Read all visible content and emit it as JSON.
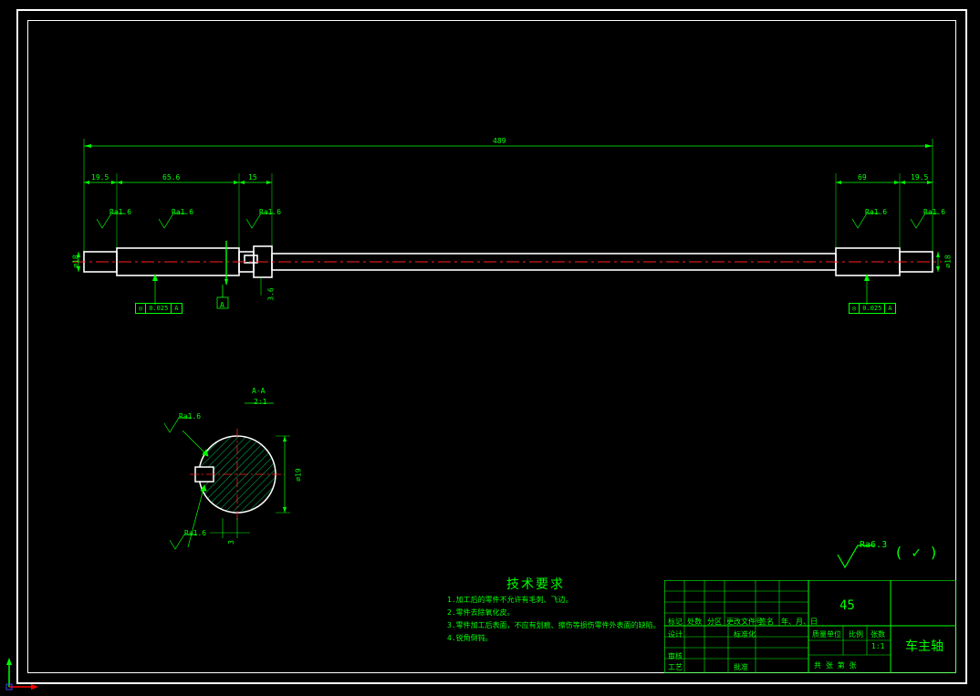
{
  "frame": {
    "outer": true,
    "inner": true
  },
  "colors": {
    "line_green": "#00ff00",
    "line_white": "#ffffff",
    "axis_red": "#ff2020",
    "ucs_magenta": "#ff00ff",
    "hatch": "#00b050"
  },
  "main_view": {
    "total_length": "489",
    "dims_top": [
      "19.5",
      "65.6",
      "15",
      "69",
      "19.5"
    ],
    "surface_labels": [
      "Ra1.6",
      "Ra1.6",
      "Ra1.6",
      "Ra1.6",
      "Ra1.6"
    ],
    "diameters_left": "⌀18",
    "diameters_right": "⌀18",
    "fcf_left": {
      "sym": "◎",
      "tol": "0.025",
      "datum": "A"
    },
    "fcf_right": {
      "sym": "◎",
      "tol": "0.025",
      "datum": "A"
    },
    "section_label": "A",
    "small_dim": "3.6"
  },
  "section_view": {
    "label": "A-A",
    "scale": "2:1",
    "surface_top": "Ra1.6",
    "surface_bottom": "Ra1.6",
    "dia": "⌀19",
    "key_h": "3"
  },
  "general_surface": {
    "value": "Ra6.3",
    "paren": "( ✓ )"
  },
  "requirements": {
    "title": "技术要求",
    "lines": [
      "1.加工后的零件不允许有毛刺、飞边。",
      "2.零件去除氧化皮。",
      "3.零件加工后表面，不应有划痕、擦伤等损伤零件外表面的缺陷。",
      "4.锐角倒钝。"
    ]
  },
  "title_block": {
    "material": "45",
    "part_name": "车主轴",
    "headers": [
      "标记",
      "处数",
      "分区",
      "更改文件号",
      "签名",
      "年、月、日"
    ],
    "rows_left": [
      "设计",
      "审核",
      "工艺"
    ],
    "rows_mid": [
      "标准化",
      "",
      "批准"
    ],
    "mass_label": "质量单位",
    "scale_label": "比例",
    "scale_value": "1:1",
    "sheet_label": "张数",
    "sht": "共   张   第   张"
  }
}
